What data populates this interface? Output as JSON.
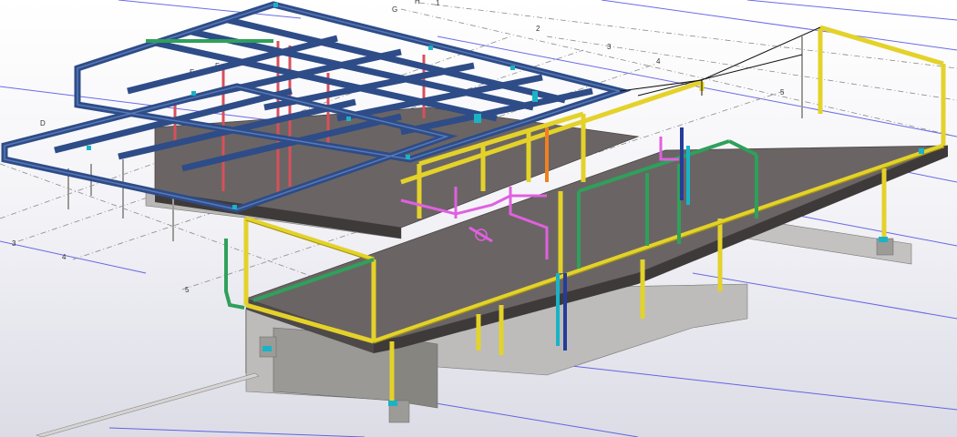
{
  "viewport": {
    "grid_letters": [
      "G",
      "H",
      "D",
      "E",
      "F"
    ],
    "grid_numbers": [
      "1",
      "2",
      "3",
      "4",
      "5",
      "3",
      "4",
      "5"
    ]
  },
  "colors": {
    "background_top": "#ffffff",
    "background_bottom": "#dcdce6",
    "grid_line_blue": "#3a3ae0",
    "dashed_grid": "#8a8a8a",
    "roof_steel": "#2e4c87",
    "roof_steel_dark": "#1d3568",
    "slab": "#6a6564",
    "slab_edge": "#4a4545",
    "yellow_steel": "#e4d22a",
    "green_steel": "#2fa05a",
    "magenta_pipe": "#e060e0",
    "red_column": "#d8505a",
    "orange_pipe": "#f08020",
    "cyan_part": "#19b3c6",
    "concrete": "#b9b8b6",
    "foundation": "#a7a6a3"
  }
}
